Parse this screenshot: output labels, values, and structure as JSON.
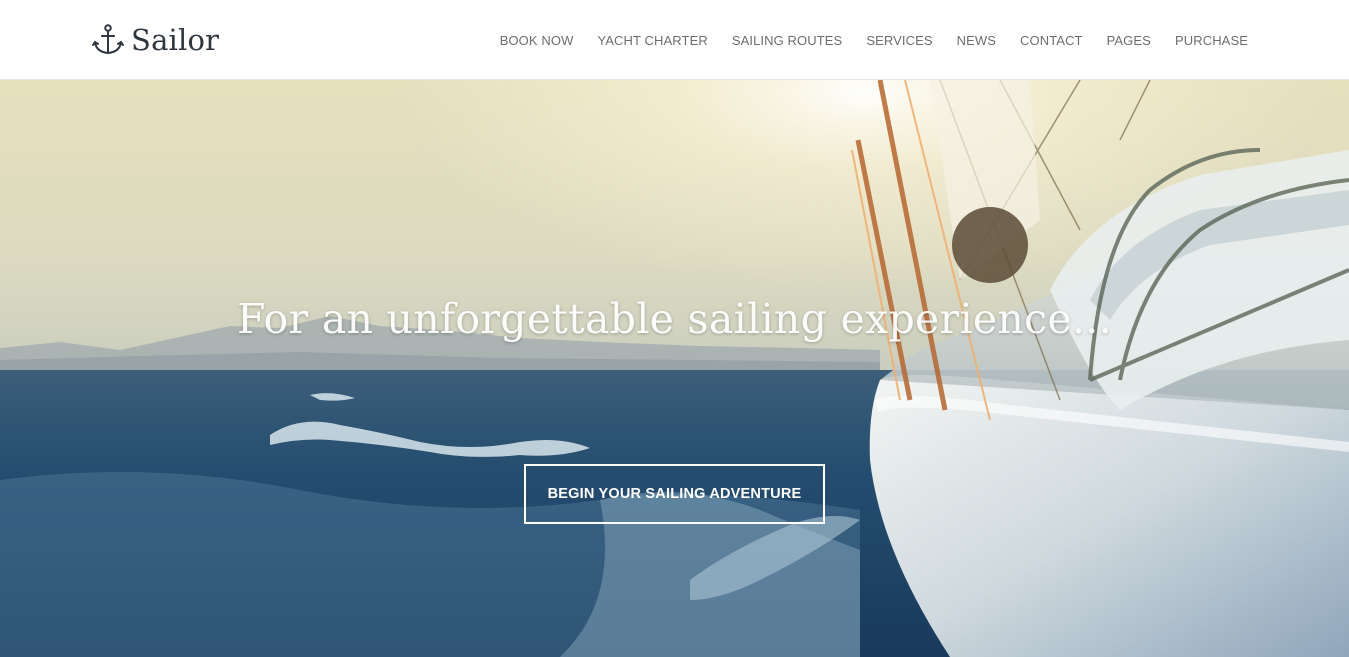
{
  "header": {
    "logo_text": "Sailor",
    "logo_icon": "anchor-icon"
  },
  "nav": {
    "items": [
      {
        "label": "BOOK NOW"
      },
      {
        "label": "YACHT CHARTER"
      },
      {
        "label": "SAILING ROUTES"
      },
      {
        "label": "SERVICES"
      },
      {
        "label": "NEWS"
      },
      {
        "label": "CONTACT"
      },
      {
        "label": "PAGES"
      },
      {
        "label": "PURCHASE"
      }
    ]
  },
  "hero": {
    "headline": "For an unforgettable sailing experience...",
    "cta_label": "BEGIN YOUR SAILING ADVENTURE"
  },
  "colors": {
    "logo": "#2f3640",
    "nav_text": "#6a6e73",
    "sea": "#1f4a6e",
    "sky": "#e8e3c4"
  }
}
